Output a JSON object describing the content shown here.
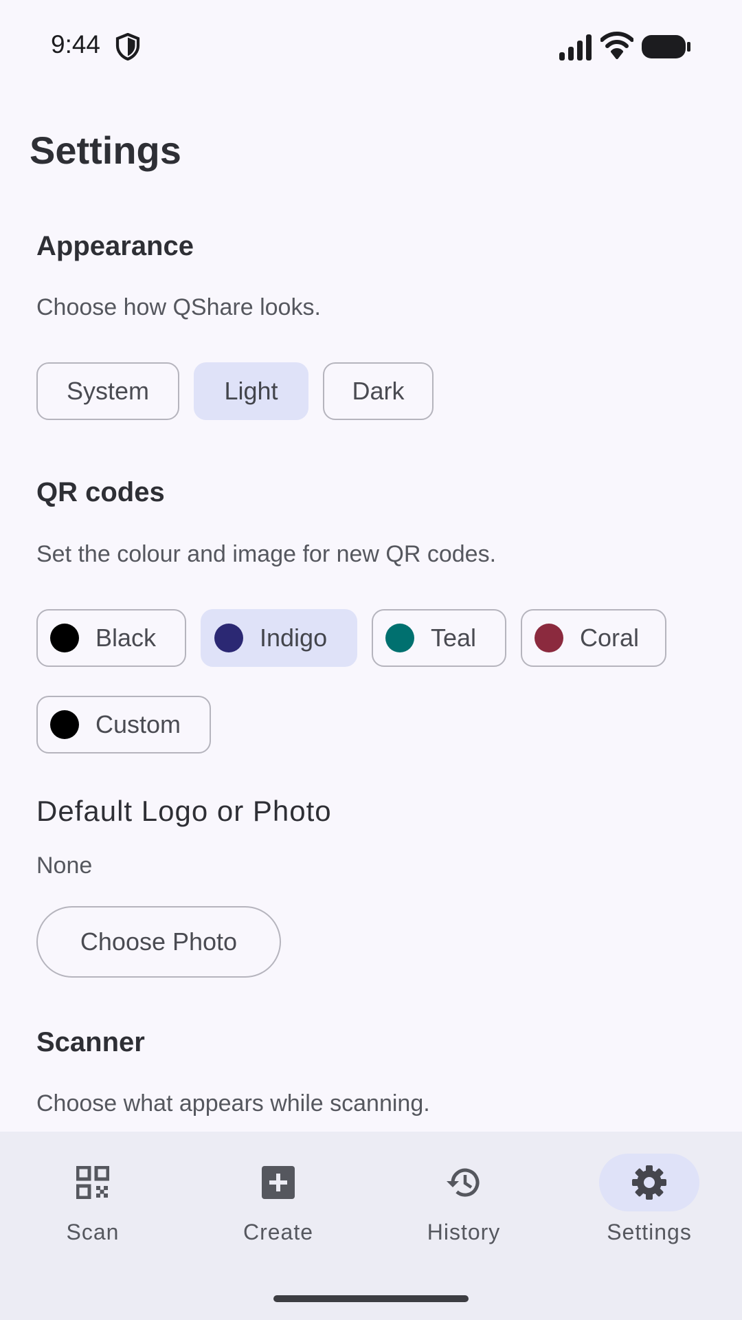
{
  "status_bar": {
    "time": "9:44",
    "icons": [
      "shield-icon",
      "signal-icon",
      "wifi-icon",
      "battery-icon"
    ]
  },
  "page": {
    "title": "Settings"
  },
  "appearance": {
    "title": "Appearance",
    "description": "Choose how QShare looks.",
    "options": [
      {
        "label": "System",
        "selected": false
      },
      {
        "label": "Light",
        "selected": true
      },
      {
        "label": "Dark",
        "selected": false
      }
    ]
  },
  "qr_codes": {
    "title": "QR codes",
    "description": "Set the colour and image for new QR codes.",
    "colors": [
      {
        "label": "Black",
        "swatch": "#000000",
        "selected": false
      },
      {
        "label": "Indigo",
        "swatch": "#2b2873",
        "selected": true
      },
      {
        "label": "Teal",
        "swatch": "#00706f",
        "selected": false
      },
      {
        "label": "Coral",
        "swatch": "#8b2a3e",
        "selected": false
      },
      {
        "label": "Custom",
        "swatch": "#000000",
        "selected": false
      }
    ],
    "logo_title": "Default Logo or Photo",
    "logo_value": "None",
    "choose_photo_label": "Choose Photo"
  },
  "scanner": {
    "title": "Scanner",
    "description": "Choose what appears while scanning."
  },
  "bottom_nav": {
    "items": [
      {
        "label": "Scan",
        "icon": "qr-scan-icon",
        "active": false
      },
      {
        "label": "Create",
        "icon": "add-box-icon",
        "active": false
      },
      {
        "label": "History",
        "icon": "history-icon",
        "active": false
      },
      {
        "label": "Settings",
        "icon": "gear-icon",
        "active": true
      }
    ]
  },
  "colors": {
    "background": "#f9f7fd",
    "selected_chip": "#dfe2f8",
    "nav_background": "#ececf4"
  }
}
